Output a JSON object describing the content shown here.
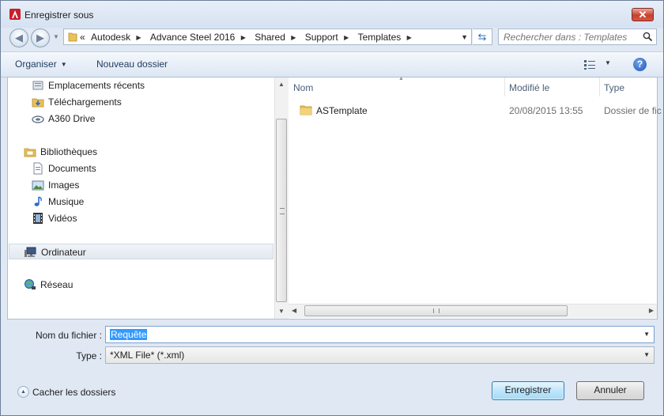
{
  "window": {
    "title": "Enregistrer sous",
    "close_label": "✕",
    "app_icon": "autocad-a-icon"
  },
  "address": {
    "crumbs": [
      "Autodesk",
      "Advance Steel 2016",
      "Shared",
      "Support",
      "Templates"
    ],
    "overflow": "«",
    "separator": "▶",
    "dropdown": "▼"
  },
  "search": {
    "placeholder": "Rechercher dans : Templates"
  },
  "toolbar": {
    "organize": "Organiser",
    "organize_caret": "▼",
    "new_folder": "Nouveau dossier",
    "view_caret": "▼",
    "help": "?"
  },
  "nav": {
    "items": [
      {
        "label": "Emplacements récents",
        "icon": "recent-places-icon"
      },
      {
        "label": "Téléchargements",
        "icon": "downloads-icon"
      },
      {
        "label": "A360 Drive",
        "icon": "a360-drive-icon"
      },
      {
        "label": "Bibliothèques",
        "icon": "libraries-icon"
      },
      {
        "label": "Documents",
        "icon": "documents-icon"
      },
      {
        "label": "Images",
        "icon": "images-icon"
      },
      {
        "label": "Musique",
        "icon": "music-icon"
      },
      {
        "label": "Vidéos",
        "icon": "videos-icon"
      },
      {
        "label": "Ordinateur",
        "icon": "computer-icon"
      },
      {
        "label": "Réseau",
        "icon": "network-icon"
      }
    ]
  },
  "files": {
    "columns": [
      "Nom",
      "Modifié le",
      "Type"
    ],
    "rows": [
      {
        "name": "ASTemplate",
        "modified": "20/08/2015 13:55",
        "type": "Dossier de fic"
      }
    ]
  },
  "form": {
    "filename_label": "Nom du fichier :",
    "filename_value": "Requête",
    "type_label": "Type :",
    "type_value": "*XML File* (*.xml)"
  },
  "footer": {
    "hide_folders": "Cacher les dossiers",
    "save": "Enregistrer",
    "cancel": "Annuler"
  },
  "scroll": {
    "up": "▲",
    "down": "▼",
    "left": "◀",
    "right": "▶"
  },
  "colors": {
    "accent": "#3399ff",
    "window_bg": "#dfe8f3"
  }
}
